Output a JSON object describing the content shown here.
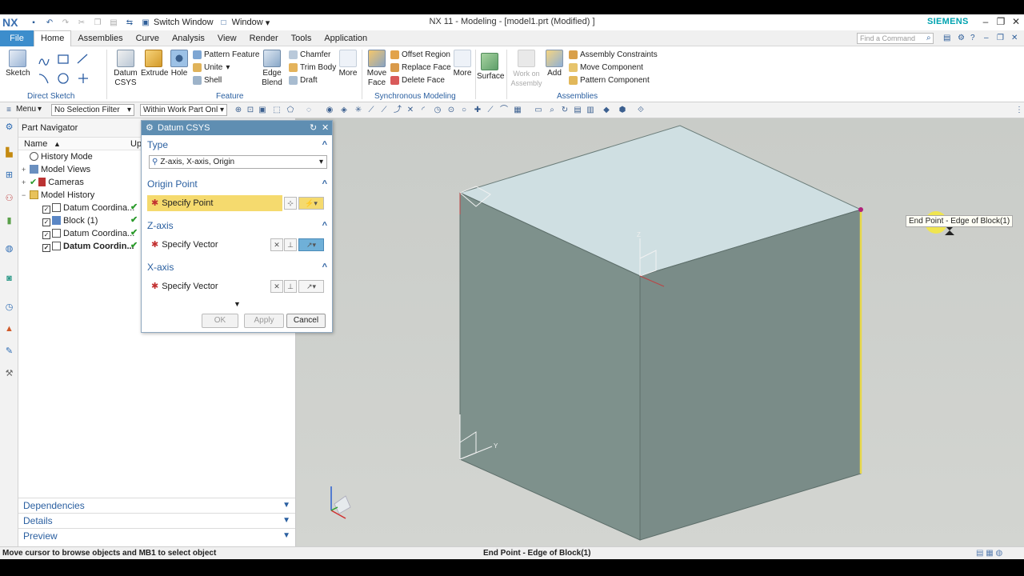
{
  "app": {
    "logo": "NX",
    "title": "NX 11 - Modeling - [model1.prt (Modified) ]",
    "brand": "SIEMENS",
    "switch_window": "Switch Window",
    "window_menu": "Window",
    "find_command_placeholder": "Find a Command"
  },
  "tabs": [
    {
      "label": "File"
    },
    {
      "label": "Home"
    },
    {
      "label": "Assemblies"
    },
    {
      "label": "Curve"
    },
    {
      "label": "Analysis"
    },
    {
      "label": "View"
    },
    {
      "label": "Render"
    },
    {
      "label": "Tools"
    },
    {
      "label": "Application"
    }
  ],
  "ribbon": {
    "direct_sketch": {
      "label": "Direct Sketch",
      "sketch": "Sketch"
    },
    "feature": {
      "label": "Feature",
      "datum_csys": "Datum CSYS",
      "extrude": "Extrude",
      "hole": "Hole",
      "pattern_feature": "Pattern Feature",
      "unite": "Unite",
      "shell": "Shell",
      "edge_blend": "Edge Blend",
      "chamfer": "Chamfer",
      "trim_body": "Trim Body",
      "draft": "Draft",
      "more": "More"
    },
    "sync": {
      "label": "Synchronous Modeling",
      "move_face": "Move Face",
      "offset_region": "Offset Region",
      "replace_face": "Replace Face",
      "delete_face": "Delete Face",
      "more": "More"
    },
    "surface": "Surface",
    "assemblies": {
      "label": "Assemblies",
      "work_on_assembly": "Work on Assembly",
      "add": "Add",
      "assembly_constraints": "Assembly Constraints",
      "move_component": "Move Component",
      "pattern_component": "Pattern Component"
    }
  },
  "selection_bar": {
    "menu": "Menu",
    "filter": "No Selection Filter",
    "scope": "Within Work Part Onl"
  },
  "navigator": {
    "title": "Part Navigator",
    "col_name": "Name",
    "col_up": "Up",
    "items": [
      {
        "label": "History Mode"
      },
      {
        "label": "Model Views"
      },
      {
        "label": "Cameras"
      },
      {
        "label": "Model History"
      },
      {
        "label": "Datum Coordina..."
      },
      {
        "label": "Block (1)"
      },
      {
        "label": "Datum Coordina..."
      },
      {
        "label": "Datum Coordin..."
      }
    ],
    "sections": {
      "dependencies": "Dependencies",
      "details": "Details",
      "preview": "Preview"
    }
  },
  "dialog": {
    "title": "Datum CSYS",
    "type_label": "Type",
    "type_value": "Z-axis, X-axis, Origin",
    "origin_label": "Origin Point",
    "specify_point": "Specify Point",
    "zaxis_label": "Z-axis",
    "xaxis_label": "X-axis",
    "specify_vector": "Specify Vector",
    "ok": "OK",
    "apply": "Apply",
    "cancel": "Cancel"
  },
  "viewport": {
    "tooltip": "End Point - Edge of Block(1)",
    "axis_z": "Z",
    "axis_y": "Y"
  },
  "status": {
    "left": "Move cursor to browse objects and MB1 to select object",
    "middle": "End Point - Edge of Block(1)"
  },
  "colors": {
    "accent": "#3c8dcc",
    "dialog_title": "#5f8eb2",
    "highlight": "#f5da6e",
    "block_front": "#7e918c",
    "block_top": "#cfdfe2",
    "edge_highlight": "#e8d84a"
  }
}
